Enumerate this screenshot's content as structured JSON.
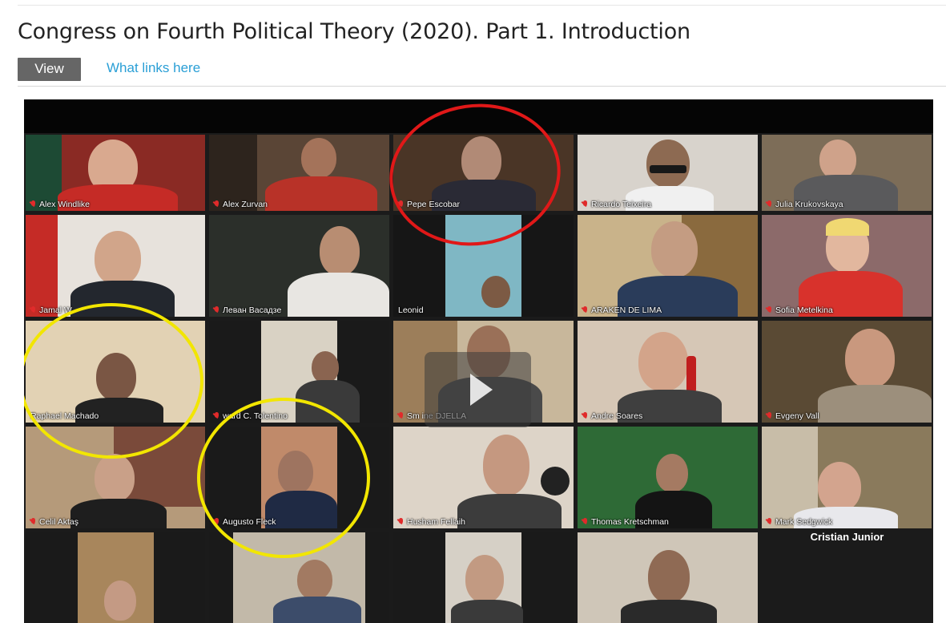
{
  "page": {
    "title": "Congress on Fourth Political Theory (2020). Part 1. Introduction",
    "tabs": [
      {
        "label": "View",
        "active": true
      },
      {
        "label": "What links here",
        "active": false
      }
    ]
  },
  "video": {
    "play_icon": "play-icon",
    "participants": [
      "Alex Windlike",
      "Alex Zurvan",
      "Pepe Escobar",
      "Ricardo Teixeira",
      "Julia Krukovskaya",
      "Jamal W",
      "Леван Васадзе",
      "Leonid",
      "ARAKEN DE LIMA",
      "Sofia Metelkina",
      "Raphael Machado",
      "ward C. Tolentino",
      "Sm     ine DJELLA",
      "Andre Soares",
      "Evgeny Vall",
      "Celil Aktaş",
      "Augusto Fleck",
      "Husham Fellaih",
      "Thomas Kretschman",
      "Mark Sedgwick",
      "",
      "",
      "",
      "",
      "Cristian Junior"
    ]
  },
  "colors": {
    "accent_link": "#2a9fd6",
    "active_tab": "#666666",
    "highlight_red": "#e01818",
    "highlight_yellow": "#f2e600"
  }
}
